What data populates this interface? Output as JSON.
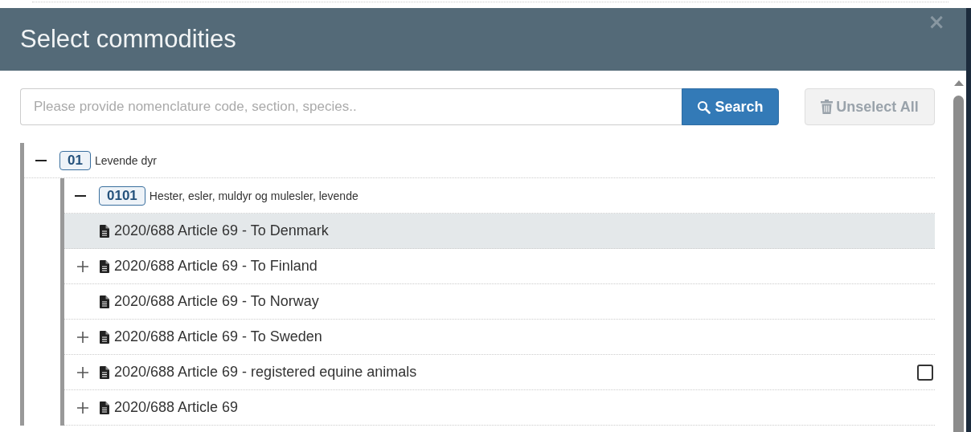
{
  "dialog": {
    "title": "Select commodities",
    "close": "×"
  },
  "search": {
    "placeholder": "Please provide nomenclature code, section, species..",
    "button": "Search"
  },
  "unselect_button": {
    "label": "Unselect All",
    "disabled": true
  },
  "tree": [
    {
      "code": "01",
      "label": "Levende dyr",
      "expanded": true,
      "children": [
        {
          "code": "0101",
          "label": "Hester, esler, muldyr og mulesler, levende",
          "expanded": true,
          "children": [
            {
              "label": "2020/688 Article 69 - To Denmark",
              "expandable": false,
              "selected": true
            },
            {
              "label": "2020/688 Article 69 - To Finland",
              "expandable": true,
              "selected": false
            },
            {
              "label": "2020/688 Article 69 - To Norway",
              "expandable": false,
              "selected": false
            },
            {
              "label": "2020/688 Article 69 - To Sweden",
              "expandable": true,
              "selected": false
            },
            {
              "label": "2020/688 Article 69 - registered equine animals",
              "expandable": true,
              "selected": false,
              "checked": false
            },
            {
              "label": "2020/688 Article 69",
              "expandable": true,
              "selected": false
            }
          ]
        }
      ]
    }
  ]
}
